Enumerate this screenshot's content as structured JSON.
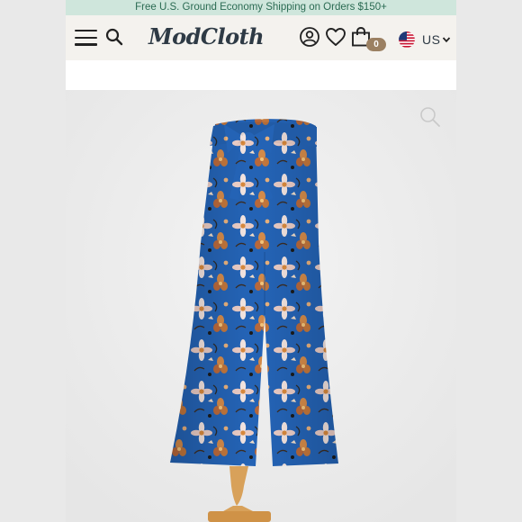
{
  "promo": {
    "text": "Free U.S. Ground Economy Shipping on Orders $150+"
  },
  "header": {
    "menu_icon": "hamburger-menu-icon",
    "search_icon": "search-icon",
    "logo": "ModCloth",
    "account_icon": "account-icon",
    "wishlist_icon": "heart-icon",
    "bag_icon": "shopping-bag-icon",
    "bag_count": "0",
    "locale_flag_icon": "us-flag-icon",
    "currency": "US"
  },
  "product": {
    "image_subject": "blue floral wide-leg pants on mannequin",
    "zoom_icon": "zoom-icon"
  },
  "colors": {
    "promo_bg": "#cfe6dc",
    "promo_text": "#2b6b53",
    "header_bg": "#f4f2ee",
    "badge_bg": "#9b8062",
    "pants_blue": "#1f5fb0"
  }
}
